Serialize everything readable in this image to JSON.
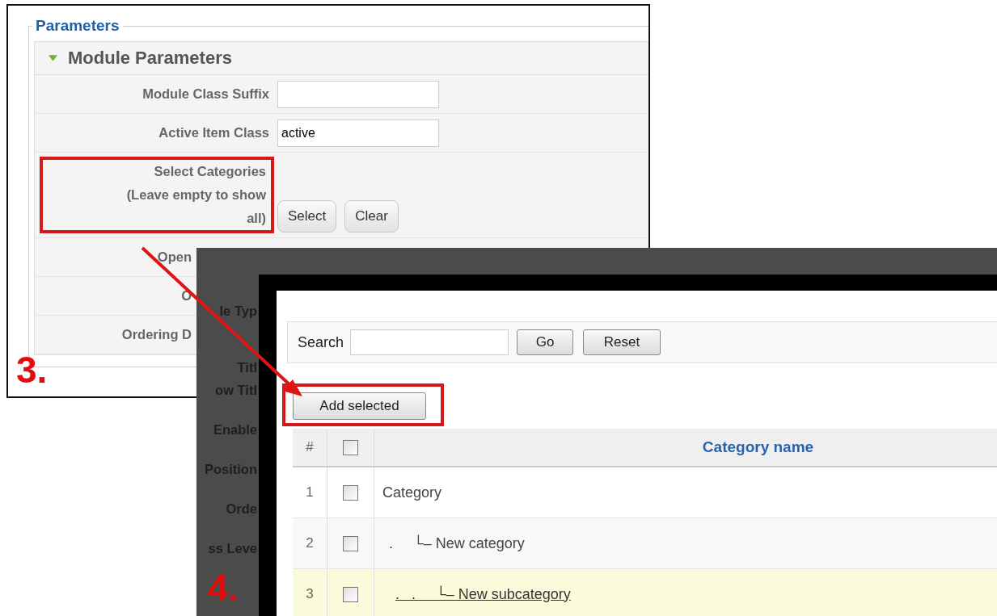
{
  "settings_panel": {
    "legend": "Parameters",
    "section": {
      "title": "Module Parameters",
      "expanded": true
    },
    "fields": [
      {
        "kind": "input",
        "label": "Module Class Suffix"
      },
      {
        "kind": "input",
        "label": "Active Item Class",
        "value": "active"
      },
      {
        "kind": "buttons",
        "label_lines": [
          "Select Categories",
          "(Leave empty to show",
          "all)"
        ],
        "buttons": [
          "Select",
          "Clear"
        ],
        "highlighted": true
      },
      {
        "kind": "label",
        "label": "Open"
      },
      {
        "kind": "label",
        "label": "O"
      },
      {
        "kind": "label",
        "label": "Ordering D"
      }
    ],
    "step_label": "3."
  },
  "background_dialog": {
    "labels": [
      "le Typ",
      "Titl",
      "ow Titl",
      "Enable",
      "Position",
      "Orde",
      "ss Leve"
    ],
    "step_label": "4."
  },
  "category_dialog": {
    "search": {
      "label": "Search"
    },
    "buttons": [
      "Go",
      "Reset"
    ],
    "add_button": {
      "label": "Add selected",
      "highlighted": true
    },
    "table": {
      "columns": [
        "#",
        "Category name"
      ],
      "header_checked": false,
      "rows": [
        {
          "number": "1",
          "name": "Category",
          "checked": false,
          "hovered": false,
          "children": [
            {
              "number": "2",
              "prefix": ".",
              "name": "└– New category",
              "checked": false,
              "hovered": false,
              "children": [
                {
                  "number": "3",
                  "prefix": ".   .",
                  "name": "└– New subcategory",
                  "checked": false,
                  "hovered": true
                }
              ]
            }
          ]
        }
      ]
    }
  }
}
